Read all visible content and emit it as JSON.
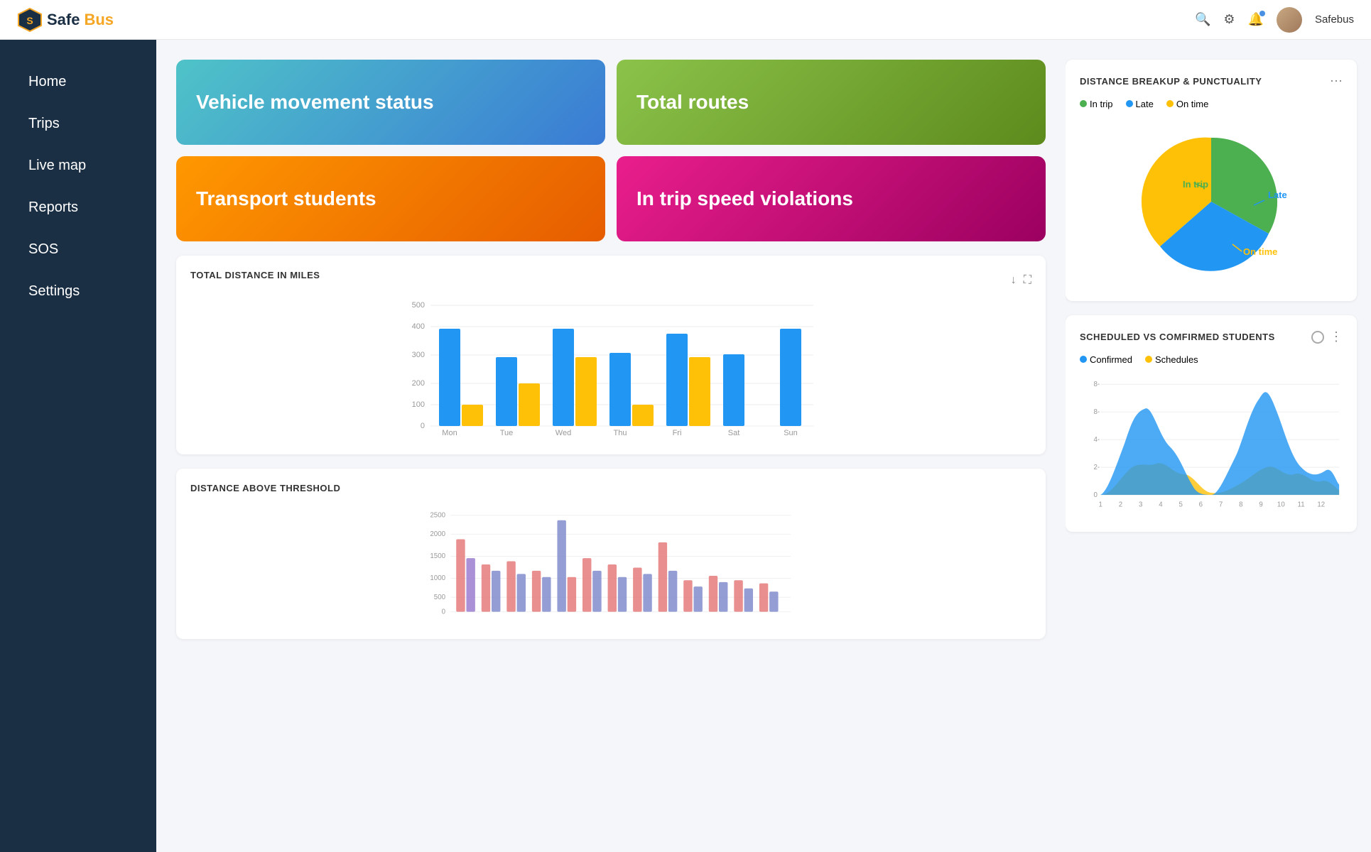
{
  "app": {
    "name_safe": "Safe",
    "name_bus": "Bus",
    "user": "Safebus"
  },
  "sidebar": {
    "items": [
      {
        "label": "Home"
      },
      {
        "label": "Trips"
      },
      {
        "label": "Live map"
      },
      {
        "label": "Reports"
      },
      {
        "label": "SOS"
      },
      {
        "label": "Settings"
      }
    ]
  },
  "stat_cards": [
    {
      "label": "Vehicle movement status",
      "class": "card-vehicle"
    },
    {
      "label": "Total routes",
      "class": "card-routes"
    },
    {
      "label": "Transport students",
      "class": "card-transport"
    },
    {
      "label": "In trip speed violations",
      "class": "card-violations"
    }
  ],
  "distance_chart": {
    "title": "TOTAL DISTANCE IN MILES",
    "y_labels": [
      "500",
      "400",
      "300",
      "200",
      "100",
      "0"
    ],
    "x_labels": [
      "Mon",
      "Tue",
      "Wed",
      "Thu",
      "Fri",
      "Sat",
      "Sun"
    ],
    "blue_bars": [
      415,
      310,
      400,
      320,
      375,
      315,
      400
    ],
    "yellow_bars": [
      110,
      155,
      245,
      110,
      245,
      0,
      0
    ]
  },
  "threshold_chart": {
    "title": "DISTANCE ABOVE THRESHOLD",
    "y_labels": [
      "2500",
      "2000",
      "1500",
      "1000",
      "500",
      "0"
    ]
  },
  "punctuality": {
    "title": "DISTANCE BREAKUP & PUNCTUALITY",
    "legend": [
      {
        "label": "In trip",
        "color": "#4caf50"
      },
      {
        "label": "Late",
        "color": "#2196f3"
      },
      {
        "label": "On time",
        "color": "#ffc107"
      }
    ],
    "slice_labels": [
      "In trip",
      "Late",
      "On time"
    ],
    "slice_colors": [
      "#4caf50",
      "#2196f3",
      "#ffc107"
    ],
    "slice_values": [
      35,
      35,
      30
    ]
  },
  "scheduled_chart": {
    "title": "SCHEDULED VS COMFIRMED STUDENTS",
    "legend": [
      {
        "label": "Confirmed",
        "color": "#2196f3"
      },
      {
        "label": "Schedules",
        "color": "#ffc107"
      }
    ],
    "x_labels": [
      "1",
      "2",
      "3",
      "4",
      "5",
      "6",
      "7",
      "8",
      "9",
      "10",
      "11",
      "12"
    ],
    "y_labels": [
      "8-",
      "8-",
      "4-",
      "2-",
      "0"
    ]
  }
}
